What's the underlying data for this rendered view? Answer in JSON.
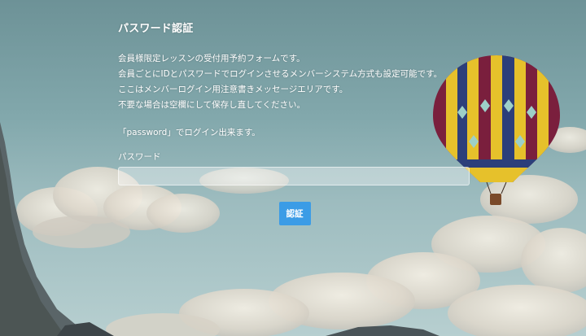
{
  "page": {
    "title": "パスワード認証"
  },
  "notice": {
    "lines": [
      "会員様限定レッスンの受付用予約フォームです。",
      "会員ごとにIDとパスワードでログインさせるメンバーシステム方式も設定可能です。",
      "ここはメンバーログイン用注意書きメッセージエリアです。",
      "不要な場合は空欄にして保存し直してください。"
    ]
  },
  "hint": "「password」でログイン出来ます。",
  "form": {
    "password_label": "パスワード",
    "password_value": "",
    "submit_label": "認証"
  },
  "colors": {
    "button": "#3b9ce6",
    "sky": "#7fa3a7"
  },
  "background": {
    "icon": "hot-air-balloon-icon"
  }
}
